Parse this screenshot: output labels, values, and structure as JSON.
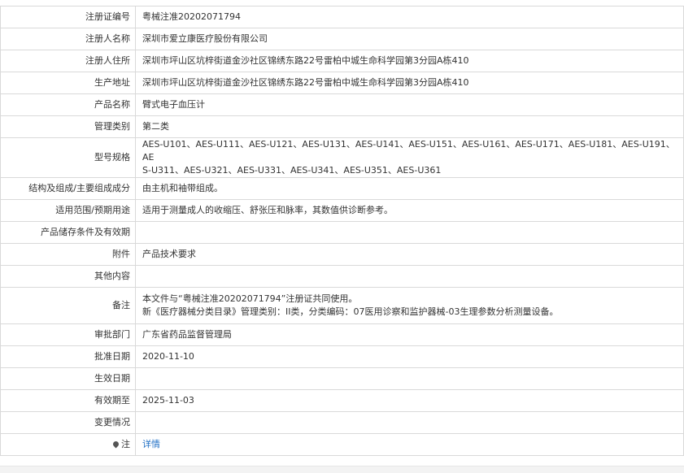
{
  "rows": [
    {
      "label": "注册证编号",
      "value": "粤械注准20202071794"
    },
    {
      "label": "注册人名称",
      "value": "深圳市爱立康医疗股份有限公司"
    },
    {
      "label": "注册人住所",
      "value": "深圳市坪山区坑梓街道金沙社区锦绣东路22号雷柏中城生命科学园第3分园A栋410"
    },
    {
      "label": "生产地址",
      "value": "深圳市坪山区坑梓街道金沙社区锦绣东路22号雷柏中城生命科学园第3分园A栋410"
    },
    {
      "label": "产品名称",
      "value": "臂式电子血压计"
    },
    {
      "label": "管理类别",
      "value": "第二类"
    },
    {
      "label": "型号规格",
      "lines": [
        "AES-U101、AES-U111、AES-U121、AES-U131、AES-U141、AES-U151、AES-U161、AES-U171、AES-U181、AES-U191、AE",
        "S-U311、AES-U321、AES-U331、AES-U341、AES-U351、AES-U361"
      ]
    },
    {
      "label": "结构及组成/主要组成成分",
      "value": "由主机和袖带组成。"
    },
    {
      "label": "适用范围/预期用途",
      "value": "适用于测量成人的收缩压、舒张压和脉率，其数值供诊断参考。"
    },
    {
      "label": "产品储存条件及有效期",
      "value": ""
    },
    {
      "label": "附件",
      "value": "产品技术要求"
    },
    {
      "label": "其他内容",
      "value": ""
    },
    {
      "label": "备注",
      "lines": [
        "本文件与“粤械注准20202071794”注册证共同使用。",
        "新《医疗器械分类目录》管理类别：II类，分类编码：07医用诊察和监护器械-03生理参数分析测量设备。"
      ]
    },
    {
      "label": "审批部门",
      "value": "广东省药品监督管理局"
    },
    {
      "label": "批准日期",
      "value": "2020-11-10"
    },
    {
      "label": "生效日期",
      "value": ""
    },
    {
      "label": "有效期至",
      "value": "2025-11-03"
    },
    {
      "label": "变更情况",
      "value": ""
    },
    {
      "label": "注",
      "value": "详情"
    }
  ],
  "icons": {
    "note": "map-pin-icon"
  },
  "colors": {
    "link": "#1f6fc5",
    "border": "#d9d9d9",
    "text": "#333333"
  }
}
